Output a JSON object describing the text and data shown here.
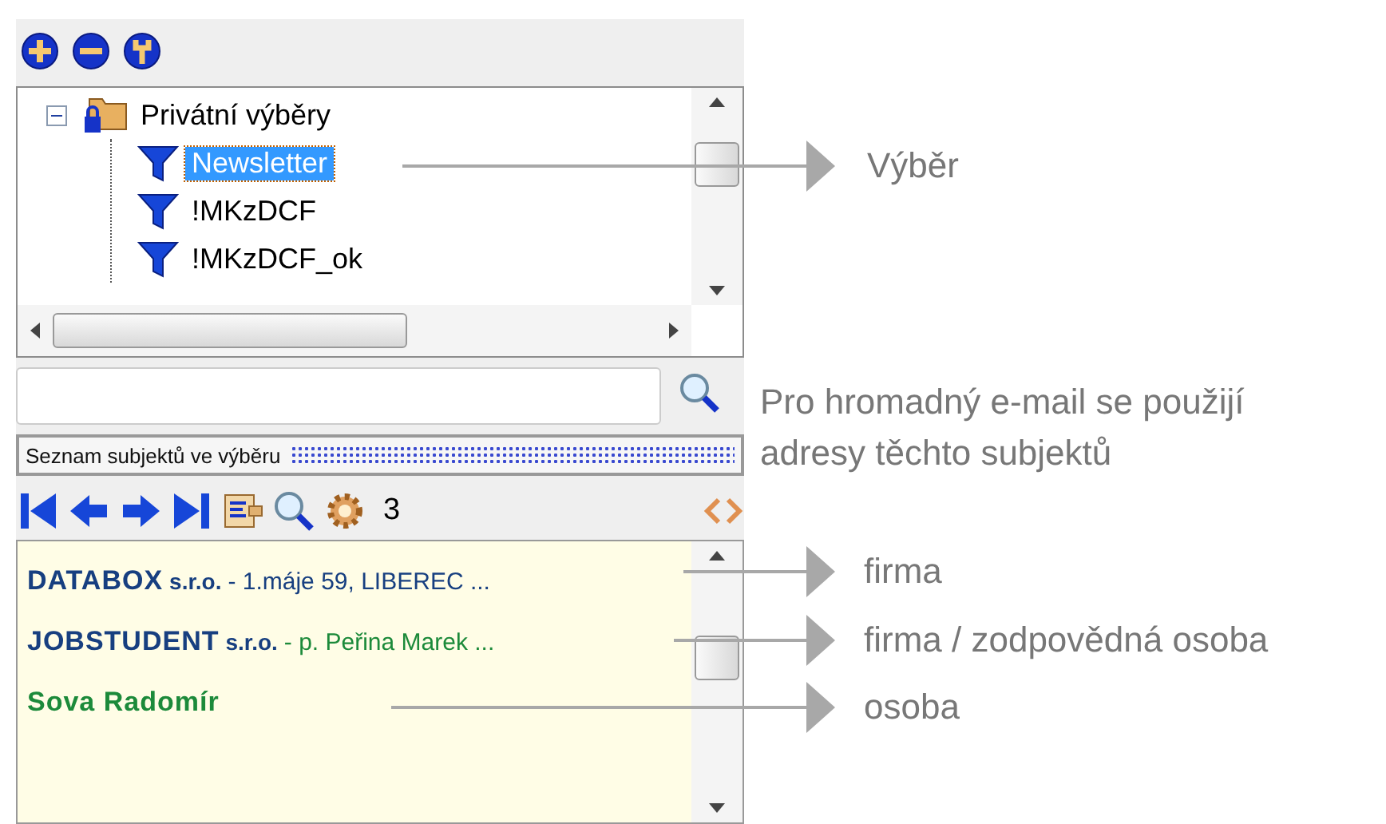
{
  "toolbar": {
    "buttons": [
      {
        "kind": "add"
      },
      {
        "kind": "remove"
      },
      {
        "kind": "settings"
      }
    ]
  },
  "tree": {
    "items": [
      {
        "label": "Privátní výběry",
        "kind": "folder",
        "expanded": true,
        "selected": false,
        "children": [
          {
            "label": "Newsletter",
            "kind": "filter",
            "selected": true
          },
          {
            "label": "!MKzDCF",
            "kind": "filter",
            "selected": false
          },
          {
            "label": "!MKzDCF_ok",
            "kind": "filter",
            "selected": false
          }
        ]
      }
    ]
  },
  "list_header": {
    "title": "Seznam subjektů ve výběru"
  },
  "navigation": {
    "buttons": [
      {
        "kind": "first"
      },
      {
        "kind": "previous"
      },
      {
        "kind": "next"
      },
      {
        "kind": "last"
      },
      {
        "kind": "detail"
      },
      {
        "kind": "search"
      },
      {
        "kind": "settings"
      }
    ],
    "count": "3"
  },
  "subjects": [
    {
      "kind": "company",
      "name": "DATABOX",
      "suffix": "s.r.o.",
      "detail": "- 1.máje 59, LIBEREC ..."
    },
    {
      "kind": "company_person",
      "name": "JOBSTUDENT",
      "suffix": "s.r.o.",
      "detail": "- p. Peřina Marek  ..."
    },
    {
      "kind": "person",
      "name": "Sova Radomír"
    }
  ],
  "callouts": [
    {
      "kind": "arrow",
      "text": "Výběr"
    },
    {
      "kind": "note",
      "text": "Pro hromadný e-mail se použijí adresy těchto subjektů"
    },
    {
      "kind": "arrow",
      "text": "firma"
    },
    {
      "kind": "arrow",
      "text": "firma / zodpovědná osoba"
    },
    {
      "kind": "arrow",
      "text": "osoba"
    }
  ]
}
